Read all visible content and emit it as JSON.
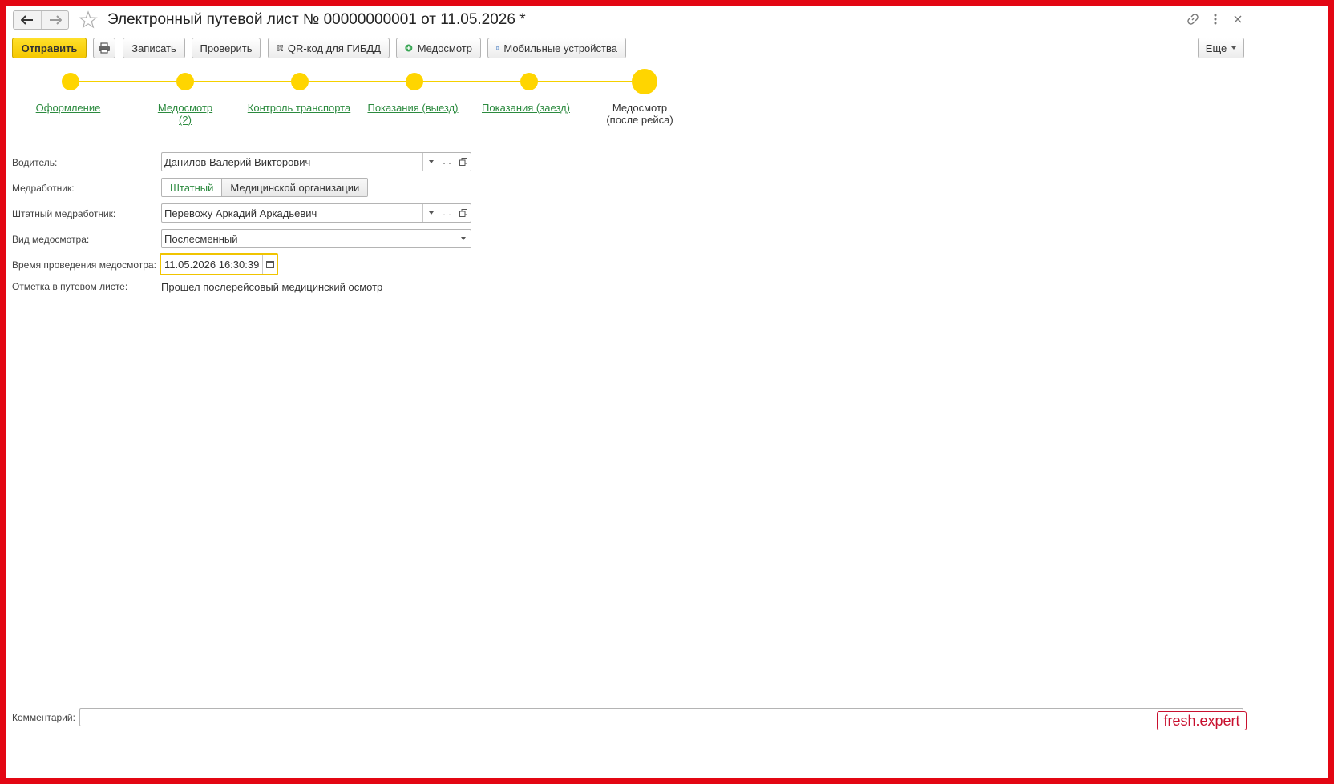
{
  "window": {
    "title": "Электронный путевой лист № 00000000001 от 11.05.2026 *"
  },
  "toolbar": {
    "send_label": "Отправить",
    "save_label": "Записать",
    "check_label": "Проверить",
    "qr_label": "QR-код для ГИБДД",
    "medcheck_label": "Медосмотр",
    "mobile_label": "Мобильные устройства",
    "more_label": "Еще"
  },
  "steps": [
    {
      "label": "Оформление",
      "sub": "",
      "state": "done"
    },
    {
      "label": "Медосмотр",
      "sub": "(2)",
      "state": "done"
    },
    {
      "label": "Контроль транспорта",
      "sub": "",
      "state": "done"
    },
    {
      "label": "Показания (выезд)",
      "sub": "",
      "state": "done"
    },
    {
      "label": "Показания (заезд)",
      "sub": "",
      "state": "done"
    },
    {
      "label": "Медосмотр",
      "sub": "(после рейса)",
      "state": "current"
    }
  ],
  "form": {
    "driver": {
      "label": "Водитель:",
      "value": "Данилов Валерий Викторович"
    },
    "medworker": {
      "label": "Медработник:",
      "options": [
        "Штатный",
        "Медицинской организации"
      ],
      "selected": "Штатный"
    },
    "staff_medworker": {
      "label": "Штатный медработник:",
      "value": "Перевожу Аркадий Аркадьевич"
    },
    "medcheck_type": {
      "label": "Вид медосмотра:",
      "value": "Послесменный"
    },
    "medcheck_time": {
      "label": "Время проведения медосмотра:",
      "value": "11.05.2026 16:30:39"
    },
    "waybill_mark": {
      "label": "Отметка в путевом листе:",
      "value": "Прошел послерейсовый медицинский осмотр"
    }
  },
  "footer": {
    "comment_label": "Комментарий:",
    "comment_value": ""
  },
  "watermark": "fresh.expert",
  "colors": {
    "frame": "#e30613",
    "accent_yellow": "#ffd500",
    "link_green": "#2b8a3e"
  }
}
